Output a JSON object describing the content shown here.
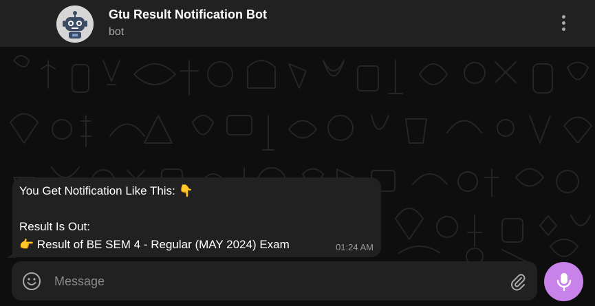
{
  "header": {
    "title": "Gtu Result Notification Bot",
    "status": "bot",
    "avatar_icon": "robot-icon",
    "menu_icon": "more-vertical-icon"
  },
  "message": {
    "line1": "You Get Notification Like This: 👇",
    "line2": "Result Is Out:",
    "line3": "👉 Result of BE SEM 4 - Regular (MAY 2024) Exam",
    "time": "01:24 AM"
  },
  "composer": {
    "placeholder": "Message",
    "emoji_icon": "smiley-icon",
    "attach_icon": "paperclip-icon",
    "send_icon": "microphone-icon"
  },
  "colors": {
    "header_bg": "#212121",
    "bubble_bg": "#212121",
    "accent": "#c882e9",
    "chat_bg": "#0e0e0e"
  }
}
